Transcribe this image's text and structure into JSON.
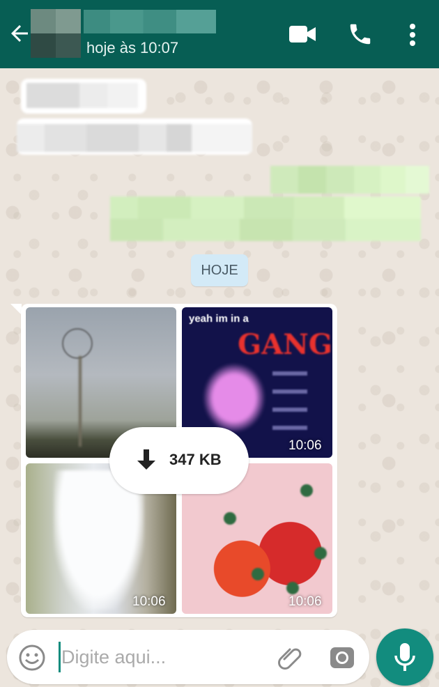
{
  "header": {
    "last_seen": "hoje às 10:07",
    "icons": [
      "back-arrow-icon",
      "video-call-icon",
      "voice-call-icon",
      "more-options-icon"
    ],
    "background_color": "#075e54"
  },
  "date_divider": {
    "label": "HOJE"
  },
  "media_message": {
    "download_size": "347 KB",
    "thumbnails": [
      {
        "time": ""
      },
      {
        "time": "10:06",
        "text_line1": "yeah im in a",
        "text_line2": "GANG"
      },
      {
        "time": "10:06"
      },
      {
        "time": "10:06"
      }
    ]
  },
  "composer": {
    "placeholder": "Digite aqui...",
    "value": "",
    "icons": [
      "emoji-icon",
      "attach-icon",
      "camera-icon",
      "mic-icon"
    ],
    "accent_color": "#128c7e"
  },
  "colors": {
    "incoming_bubble": "#ffffff",
    "outgoing_bubble": "#dcf8c6",
    "date_pill": "#d3eaf7",
    "wallpaper": "#ece5dd"
  }
}
